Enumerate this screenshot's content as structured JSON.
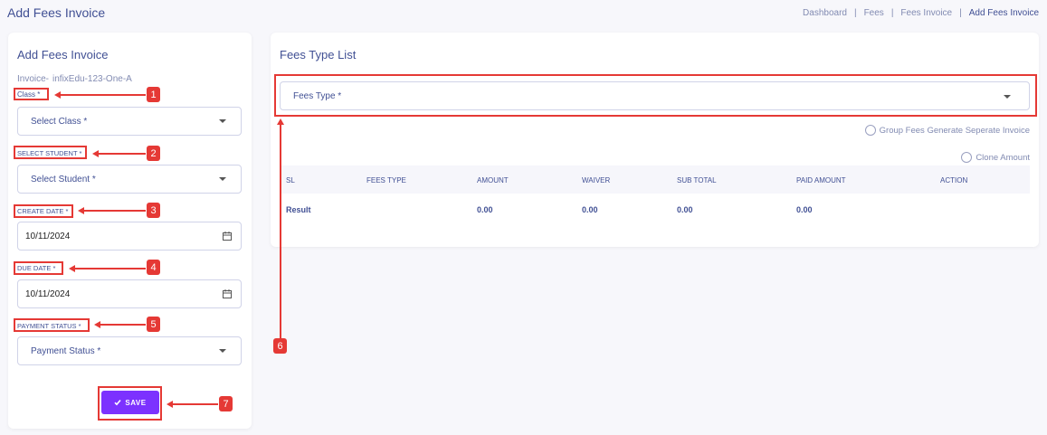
{
  "page": {
    "title": "Add Fees Invoice",
    "breadcrumb": [
      "Dashboard",
      "Fees",
      "Fees Invoice",
      "Add Fees Invoice"
    ],
    "separator": "|"
  },
  "left_panel": {
    "title": "Add Fees Invoice",
    "invoice_label": "Invoice-",
    "invoice_number": "infixEdu-123-One-A",
    "class": {
      "label": "Class *",
      "placeholder": "Select Class *"
    },
    "student": {
      "label": "SELECT STUDENT *",
      "placeholder": "Select Student *"
    },
    "create_date": {
      "label": "CREATE DATE *",
      "value": "10/11/2024"
    },
    "due_date": {
      "label": "DUE DATE *",
      "value": "10/11/2024"
    },
    "payment_status": {
      "label": "PAYMENT STATUS *",
      "placeholder": "Payment Status *"
    },
    "save_label": "SAVE",
    "save_icon": "check-icon"
  },
  "right_panel": {
    "title": "Fees Type List",
    "fees_type_placeholder": "Fees Type *",
    "group_fees_option": "Group Fees Generate Seperate Invoice",
    "clone_amount_option": "Clone Amount",
    "table": {
      "columns": [
        "SL",
        "FEES TYPE",
        "AMOUNT",
        "WAIVER",
        "SUB TOTAL",
        "PAID AMOUNT",
        "ACTION"
      ],
      "result_row": {
        "label": "Result",
        "amount": "0.00",
        "waiver": "0.00",
        "sub_total": "0.00",
        "paid_amount": "0.00"
      }
    }
  },
  "annotations": {
    "markers": [
      "1",
      "2",
      "3",
      "4",
      "5",
      "6",
      "7"
    ],
    "color": "#e53935"
  },
  "colors": {
    "accent": "#7c32ff",
    "text": "#415094",
    "muted": "#828bb2"
  }
}
